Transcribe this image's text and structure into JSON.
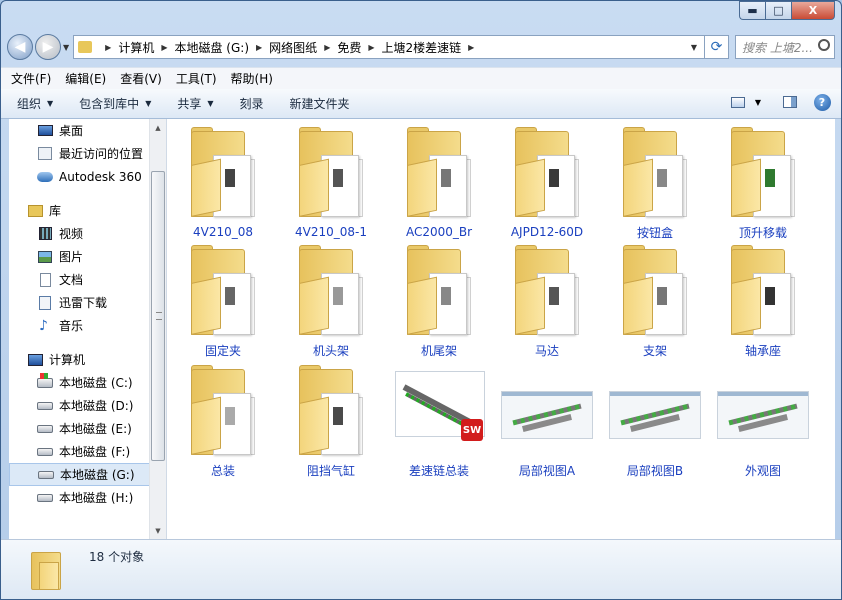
{
  "window": {
    "caption_buttons": {
      "minimize": "▬",
      "maximize": "□",
      "close": "X"
    }
  },
  "nav": {
    "back_icon": "back-arrow-icon",
    "forward_icon": "forward-arrow-icon",
    "breadcrumb": [
      "计算机",
      "本地磁盘 (G:)",
      "网络图纸",
      "免费",
      "上塘2楼差速链"
    ],
    "search_placeholder": "搜索 上塘2..."
  },
  "menu": [
    "文件(F)",
    "编辑(E)",
    "查看(V)",
    "工具(T)",
    "帮助(H)"
  ],
  "toolbar": {
    "organize": "组织",
    "include_library": "包含到库中",
    "share": "共享",
    "burn": "刻录",
    "new_folder": "新建文件夹"
  },
  "sidebar": {
    "favorites": [
      {
        "label": "桌面",
        "icon": "desktop-icon"
      },
      {
        "label": "最近访问的位置",
        "icon": "recent-places-icon"
      },
      {
        "label": "Autodesk 360",
        "icon": "cloud-icon"
      }
    ],
    "library_header": "库",
    "libraries": [
      {
        "label": "视频",
        "icon": "video-icon"
      },
      {
        "label": "图片",
        "icon": "pictures-icon"
      },
      {
        "label": "文档",
        "icon": "documents-icon"
      },
      {
        "label": "迅雷下载",
        "icon": "download-icon"
      },
      {
        "label": "音乐",
        "icon": "music-icon"
      }
    ],
    "computer_header": "计算机",
    "drives": [
      {
        "label": "本地磁盘 (C:)",
        "selected": false
      },
      {
        "label": "本地磁盘 (D:)",
        "selected": false
      },
      {
        "label": "本地磁盘 (E:)",
        "selected": false
      },
      {
        "label": "本地磁盘 (F:)",
        "selected": false
      },
      {
        "label": "本地磁盘 (G:)",
        "selected": true
      },
      {
        "label": "本地磁盘 (H:)",
        "selected": false
      }
    ]
  },
  "items": [
    {
      "name": "4V210_08",
      "type": "folder"
    },
    {
      "name": "4V210_08-1",
      "type": "folder"
    },
    {
      "name": "AC2000_Br",
      "type": "folder"
    },
    {
      "name": "AJPD12-60D",
      "type": "folder"
    },
    {
      "name": "按钮盒",
      "type": "folder"
    },
    {
      "name": "顶升移载",
      "type": "folder"
    },
    {
      "name": "固定夹",
      "type": "folder"
    },
    {
      "name": "机头架",
      "type": "folder"
    },
    {
      "name": "机尾架",
      "type": "folder"
    },
    {
      "name": "马达",
      "type": "folder"
    },
    {
      "name": "支架",
      "type": "folder"
    },
    {
      "name": "轴承座",
      "type": "folder"
    },
    {
      "name": "总装",
      "type": "folder"
    },
    {
      "name": "阻挡气缸",
      "type": "folder"
    },
    {
      "name": "差速链总装",
      "type": "solidworks-assembly"
    },
    {
      "name": "局部视图A",
      "type": "image"
    },
    {
      "name": "局部视图B",
      "type": "image"
    },
    {
      "name": "外观图",
      "type": "image"
    }
  ],
  "status": {
    "count": "18 个对象"
  },
  "colors": {
    "link_text": "#1a3fbf",
    "folder": "#e7c25d",
    "selection": "#dce9f7"
  }
}
